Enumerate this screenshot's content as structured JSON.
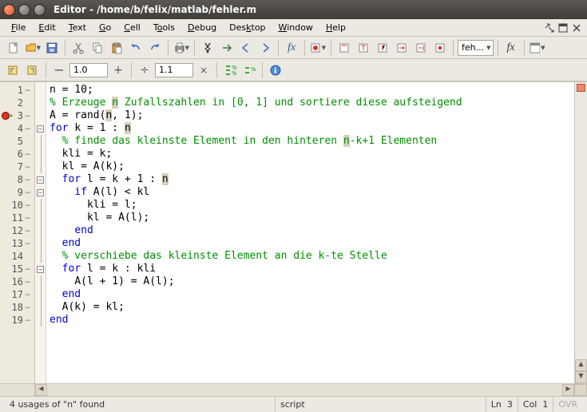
{
  "window": {
    "title": "Editor - /home/b/felix/matlab/fehler.m"
  },
  "menu": {
    "items": [
      "File",
      "Edit",
      "Text",
      "Go",
      "Cell",
      "Tools",
      "Debug",
      "Desktop",
      "Window",
      "Help"
    ]
  },
  "toolbar2": {
    "val1": "1.0",
    "val2": "1.1"
  },
  "stack_combo": "feh...",
  "code": {
    "lines": [
      {
        "n": 1,
        "dash": true,
        "fold": "",
        "indent": 0,
        "segs": [
          {
            "t": "n = 10;",
            "c": ""
          }
        ]
      },
      {
        "n": 2,
        "dash": false,
        "fold": "",
        "indent": 0,
        "segs": [
          {
            "t": "% Erzeuge ",
            "c": "cm"
          },
          {
            "t": "n",
            "c": "cm hl"
          },
          {
            "t": " Zufallszahlen in [0, 1] und sortiere diese aufsteigend",
            "c": "cm"
          }
        ]
      },
      {
        "n": 3,
        "dash": true,
        "fold": "",
        "indent": 0,
        "bp": true,
        "cur": true,
        "segs": [
          {
            "t": "A = rand(",
            "c": ""
          },
          {
            "t": "n",
            "c": "hl"
          },
          {
            "t": ", 1);",
            "c": ""
          }
        ]
      },
      {
        "n": 4,
        "dash": true,
        "fold": "box",
        "indent": 0,
        "segs": [
          {
            "t": "for ",
            "c": "kw"
          },
          {
            "t": "k = 1 : ",
            "c": ""
          },
          {
            "t": "n",
            "c": "hl"
          }
        ]
      },
      {
        "n": 5,
        "dash": false,
        "fold": "line",
        "indent": 1,
        "segs": [
          {
            "t": "% finde das kleinste Element in den hinteren ",
            "c": "cm"
          },
          {
            "t": "n",
            "c": "cm hl"
          },
          {
            "t": "-k+1 Elementen",
            "c": "cm"
          }
        ]
      },
      {
        "n": 6,
        "dash": true,
        "fold": "line",
        "indent": 1,
        "segs": [
          {
            "t": "kli = k;",
            "c": ""
          }
        ]
      },
      {
        "n": 7,
        "dash": true,
        "fold": "line",
        "indent": 1,
        "segs": [
          {
            "t": "kl = A(k);",
            "c": ""
          }
        ]
      },
      {
        "n": 8,
        "dash": true,
        "fold": "box",
        "indent": 1,
        "segs": [
          {
            "t": "for ",
            "c": "kw"
          },
          {
            "t": "l = k + 1 : ",
            "c": ""
          },
          {
            "t": "n",
            "c": "hl"
          }
        ]
      },
      {
        "n": 9,
        "dash": true,
        "fold": "box",
        "indent": 2,
        "segs": [
          {
            "t": "if ",
            "c": "kw"
          },
          {
            "t": "A(l) < kl",
            "c": ""
          }
        ]
      },
      {
        "n": 10,
        "dash": true,
        "fold": "line",
        "indent": 3,
        "segs": [
          {
            "t": "kli = l;",
            "c": ""
          }
        ]
      },
      {
        "n": 11,
        "dash": true,
        "fold": "line",
        "indent": 3,
        "segs": [
          {
            "t": "kl = A(l);",
            "c": ""
          }
        ]
      },
      {
        "n": 12,
        "dash": true,
        "fold": "end",
        "indent": 2,
        "segs": [
          {
            "t": "end",
            "c": "kw"
          }
        ]
      },
      {
        "n": 13,
        "dash": true,
        "fold": "end",
        "indent": 1,
        "segs": [
          {
            "t": "end",
            "c": "kw"
          }
        ]
      },
      {
        "n": 14,
        "dash": false,
        "fold": "line",
        "indent": 1,
        "segs": [
          {
            "t": "% verschiebe das kleinste Element an die k-te Stelle",
            "c": "cm"
          }
        ]
      },
      {
        "n": 15,
        "dash": true,
        "fold": "box",
        "indent": 1,
        "segs": [
          {
            "t": "for ",
            "c": "kw"
          },
          {
            "t": "l = k : kli",
            "c": ""
          }
        ]
      },
      {
        "n": 16,
        "dash": true,
        "fold": "line",
        "indent": 2,
        "segs": [
          {
            "t": "A(l + 1) = A(l);",
            "c": ""
          }
        ]
      },
      {
        "n": 17,
        "dash": true,
        "fold": "end",
        "indent": 1,
        "segs": [
          {
            "t": "end",
            "c": "kw"
          }
        ]
      },
      {
        "n": 18,
        "dash": true,
        "fold": "line",
        "indent": 1,
        "segs": [
          {
            "t": "A(k) = kl;",
            "c": ""
          }
        ]
      },
      {
        "n": 19,
        "dash": true,
        "fold": "end",
        "indent": 0,
        "segs": [
          {
            "t": "end",
            "c": "kw"
          }
        ]
      }
    ]
  },
  "status": {
    "msg": "4 usages of \"n\" found",
    "type": "script",
    "ln_label": "Ln",
    "ln": "3",
    "col_label": "Col",
    "col": "1",
    "ovr": "OVR"
  }
}
